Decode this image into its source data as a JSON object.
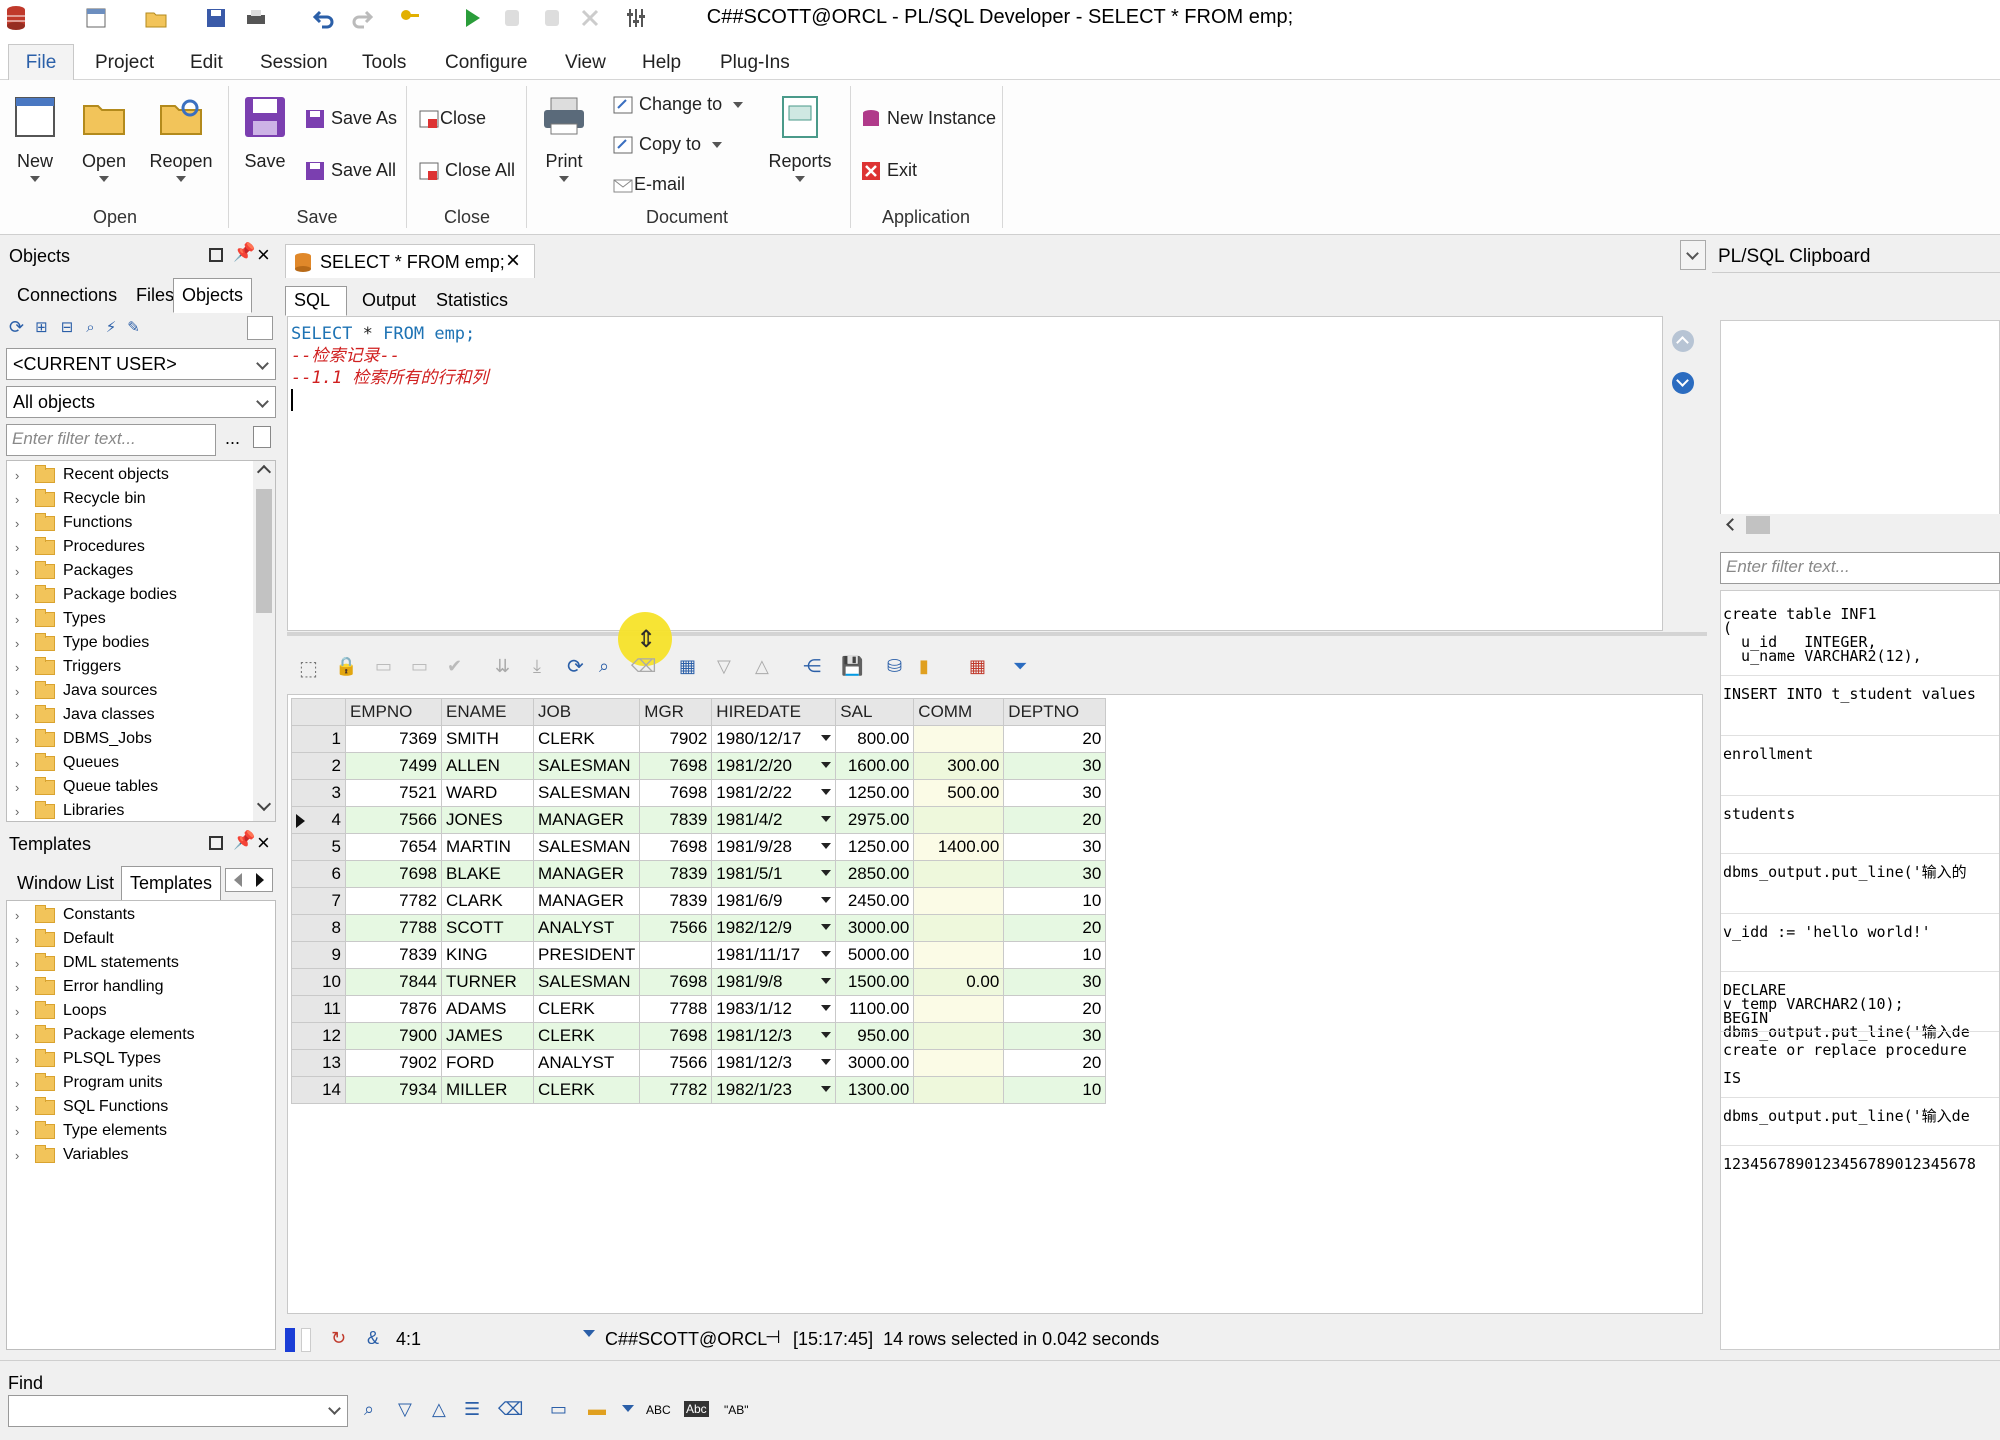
{
  "window": {
    "title": "C##SCOTT@ORCL - PL/SQL Developer - SELECT * FROM emp;"
  },
  "menu": [
    "File",
    "Project",
    "Edit",
    "Session",
    "Tools",
    "Configure",
    "View",
    "Help",
    "Plug-Ins"
  ],
  "ribbon": {
    "new": "New",
    "open": "Open",
    "reopen": "Reopen",
    "group_open": "Open",
    "save": "Save",
    "save_as": "Save As",
    "save_all": "Save All",
    "group_save": "Save",
    "close": "Close",
    "close_all": "Close All",
    "group_close": "Close",
    "print": "Print",
    "change_to": "Change to",
    "copy_to": "Copy to",
    "email": "E-mail",
    "group_document": "Document",
    "reports": "Reports",
    "new_instance": "New Instance",
    "exit": "Exit",
    "group_application": "Application"
  },
  "objects_panel": {
    "title": "Objects",
    "tabs": [
      "Connections",
      "Files",
      "Objects"
    ],
    "user_combo": "<CURRENT USER>",
    "filter_combo": "All objects",
    "filter_placeholder": "Enter filter text...",
    "more": "...",
    "items": [
      "Recent objects",
      "Recycle bin",
      "Functions",
      "Procedures",
      "Packages",
      "Package bodies",
      "Types",
      "Type bodies",
      "Triggers",
      "Java sources",
      "Java classes",
      "DBMS_Jobs",
      "Queues",
      "Queue tables",
      "Libraries"
    ]
  },
  "templates_panel": {
    "title": "Templates",
    "tabs": [
      "Window List",
      "Templates"
    ],
    "items": [
      "Constants",
      "Default",
      "DML statements",
      "Error handling",
      "Loops",
      "Package elements",
      "PLSQL Types",
      "Program units",
      "SQL Functions",
      "Type elements",
      "Variables"
    ]
  },
  "doc_tab": {
    "label": "SELECT * FROM emp;"
  },
  "editor_tabs": [
    "SQL",
    "Output",
    "Statistics"
  ],
  "editor": {
    "line1_kw1": "SELECT",
    "line1_mid": " * ",
    "line1_kw2": "FROM",
    "line1_rest": " emp;",
    "line2": "--检索记录--",
    "line3": "--1.1 检索所有的行和列"
  },
  "grid": {
    "columns": [
      "EMPNO",
      "ENAME",
      "JOB",
      "MGR",
      "HIREDATE",
      "SAL",
      "COMM",
      "DEPTNO"
    ],
    "rows": [
      [
        "1",
        "7369",
        "SMITH",
        "CLERK",
        "7902",
        "1980/12/17",
        "800.00",
        "",
        "20"
      ],
      [
        "2",
        "7499",
        "ALLEN",
        "SALESMAN",
        "7698",
        "1981/2/20",
        "1600.00",
        "300.00",
        "30"
      ],
      [
        "3",
        "7521",
        "WARD",
        "SALESMAN",
        "7698",
        "1981/2/22",
        "1250.00",
        "500.00",
        "30"
      ],
      [
        "4",
        "7566",
        "JONES",
        "MANAGER",
        "7839",
        "1981/4/2",
        "2975.00",
        "",
        "20"
      ],
      [
        "5",
        "7654",
        "MARTIN",
        "SALESMAN",
        "7698",
        "1981/9/28",
        "1250.00",
        "1400.00",
        "30"
      ],
      [
        "6",
        "7698",
        "BLAKE",
        "MANAGER",
        "7839",
        "1981/5/1",
        "2850.00",
        "",
        "30"
      ],
      [
        "7",
        "7782",
        "CLARK",
        "MANAGER",
        "7839",
        "1981/6/9",
        "2450.00",
        "",
        "10"
      ],
      [
        "8",
        "7788",
        "SCOTT",
        "ANALYST",
        "7566",
        "1982/12/9",
        "3000.00",
        "",
        "20"
      ],
      [
        "9",
        "7839",
        "KING",
        "PRESIDENT",
        "",
        "1981/11/17",
        "5000.00",
        "",
        "10"
      ],
      [
        "10",
        "7844",
        "TURNER",
        "SALESMAN",
        "7698",
        "1981/9/8",
        "1500.00",
        "0.00",
        "30"
      ],
      [
        "11",
        "7876",
        "ADAMS",
        "CLERK",
        "7788",
        "1983/1/12",
        "1100.00",
        "",
        "20"
      ],
      [
        "12",
        "7900",
        "JAMES",
        "CLERK",
        "7698",
        "1981/12/3",
        "950.00",
        "",
        "30"
      ],
      [
        "13",
        "7902",
        "FORD",
        "ANALYST",
        "7566",
        "1981/12/3",
        "3000.00",
        "",
        "20"
      ],
      [
        "14",
        "7934",
        "MILLER",
        "CLERK",
        "7782",
        "1982/1/23",
        "1300.00",
        "",
        "10"
      ]
    ],
    "current_row": "4"
  },
  "status": {
    "position": "4:1",
    "connection": "C##SCOTT@ORCL",
    "message": "[15:17:45]  14 rows selected in 0.042 seconds"
  },
  "clipboard": {
    "title": "PL/SQL Clipboard",
    "filter_placeholder": "Enter filter text...",
    "entries": [
      [
        "create table INF1",
        "(",
        "  u_id   INTEGER,",
        "  u_name VARCHAR2(12),"
      ],
      [
        "INSERT INTO t_student values"
      ],
      [
        "enrollment"
      ],
      [
        "students"
      ],
      [
        "dbms_output.put_line('输入的"
      ],
      [
        "v_idd := 'hello world!'"
      ],
      [
        "DECLARE",
        "v_temp VARCHAR2(10);",
        "BEGIN",
        "dbms_output.put_line('输入de"
      ],
      [
        "create or replace procedure",
        "",
        "IS"
      ],
      [
        "dbms_output.put_line('输入de"
      ],
      [
        "1234567890123456789012345678"
      ]
    ]
  },
  "find": {
    "label": "Find",
    "abc": "ABC",
    "ab_quoted": "\"AB\"",
    "abc_word": "Abc"
  }
}
